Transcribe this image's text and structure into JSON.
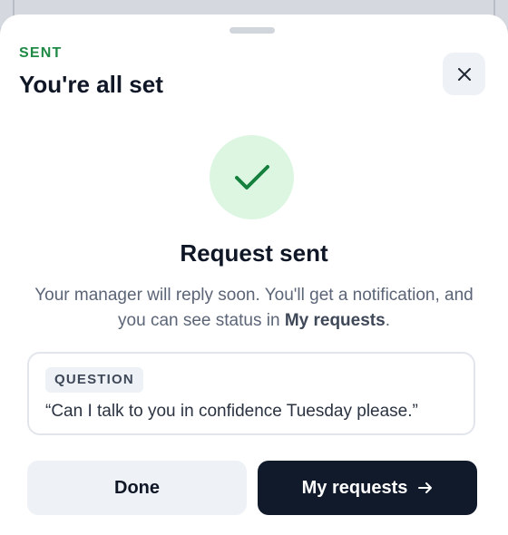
{
  "sheet": {
    "eyebrow": "SENT",
    "title": "You're all set",
    "close_icon": "close-icon"
  },
  "confirmation": {
    "icon": "checkmark-icon",
    "heading": "Request sent",
    "body_prefix": "Your manager will reply soon. You'll get a notification, and you can see status in ",
    "body_link": "My requests",
    "body_suffix": "."
  },
  "question": {
    "tag": "QUESTION",
    "text": "“Can I talk to you in confidence Tuesday please.”"
  },
  "actions": {
    "done_label": "Done",
    "my_requests_label": "My requests",
    "my_requests_icon": "arrow-right-icon"
  },
  "colors": {
    "accent_green": "#1f8a45",
    "success_bg": "#dcf6e2",
    "primary_button": "#111a2b",
    "secondary_button": "#eef2f6"
  }
}
